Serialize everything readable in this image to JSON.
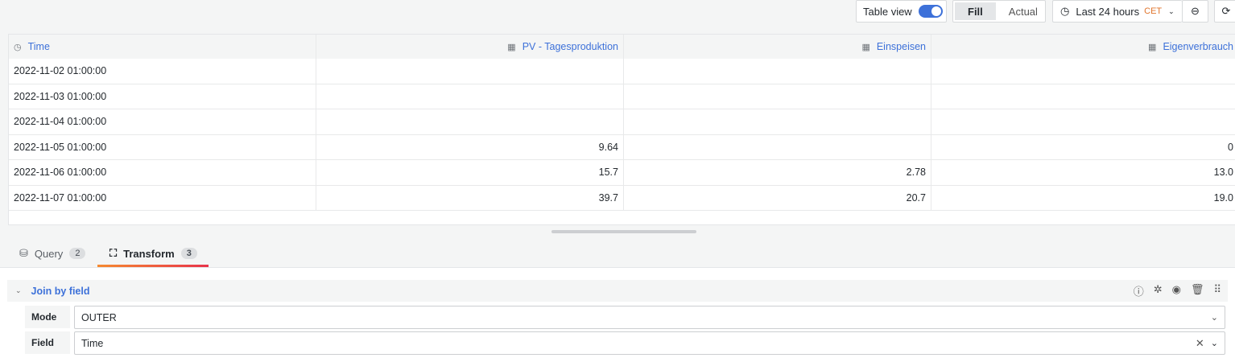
{
  "toolbar": {
    "table_view": "Table view",
    "fill": "Fill",
    "actual": "Actual",
    "time_range": "Last 24 hours",
    "timezone": "CET"
  },
  "table": {
    "columns": [
      "Time",
      "PV - Tagesproduktion",
      "Einspeisen",
      "Eigenverbrauch"
    ],
    "rows": [
      [
        "2022-11-02 01:00:00",
        "",
        "",
        ""
      ],
      [
        "2022-11-03 01:00:00",
        "",
        "",
        ""
      ],
      [
        "2022-11-04 01:00:00",
        "",
        "",
        ""
      ],
      [
        "2022-11-05 01:00:00",
        "9.64",
        "",
        "0"
      ],
      [
        "2022-11-06 01:00:00",
        "15.7",
        "2.78",
        "13.0"
      ],
      [
        "2022-11-07 01:00:00",
        "39.7",
        "20.7",
        "19.0"
      ]
    ]
  },
  "tabs": [
    {
      "label": "Query",
      "count": "2"
    },
    {
      "label": "Transform",
      "count": "3"
    }
  ],
  "transform": {
    "title": "Join by field",
    "mode_label": "Mode",
    "mode_value": "OUTER",
    "field_label": "Field",
    "field_value": "Time"
  }
}
